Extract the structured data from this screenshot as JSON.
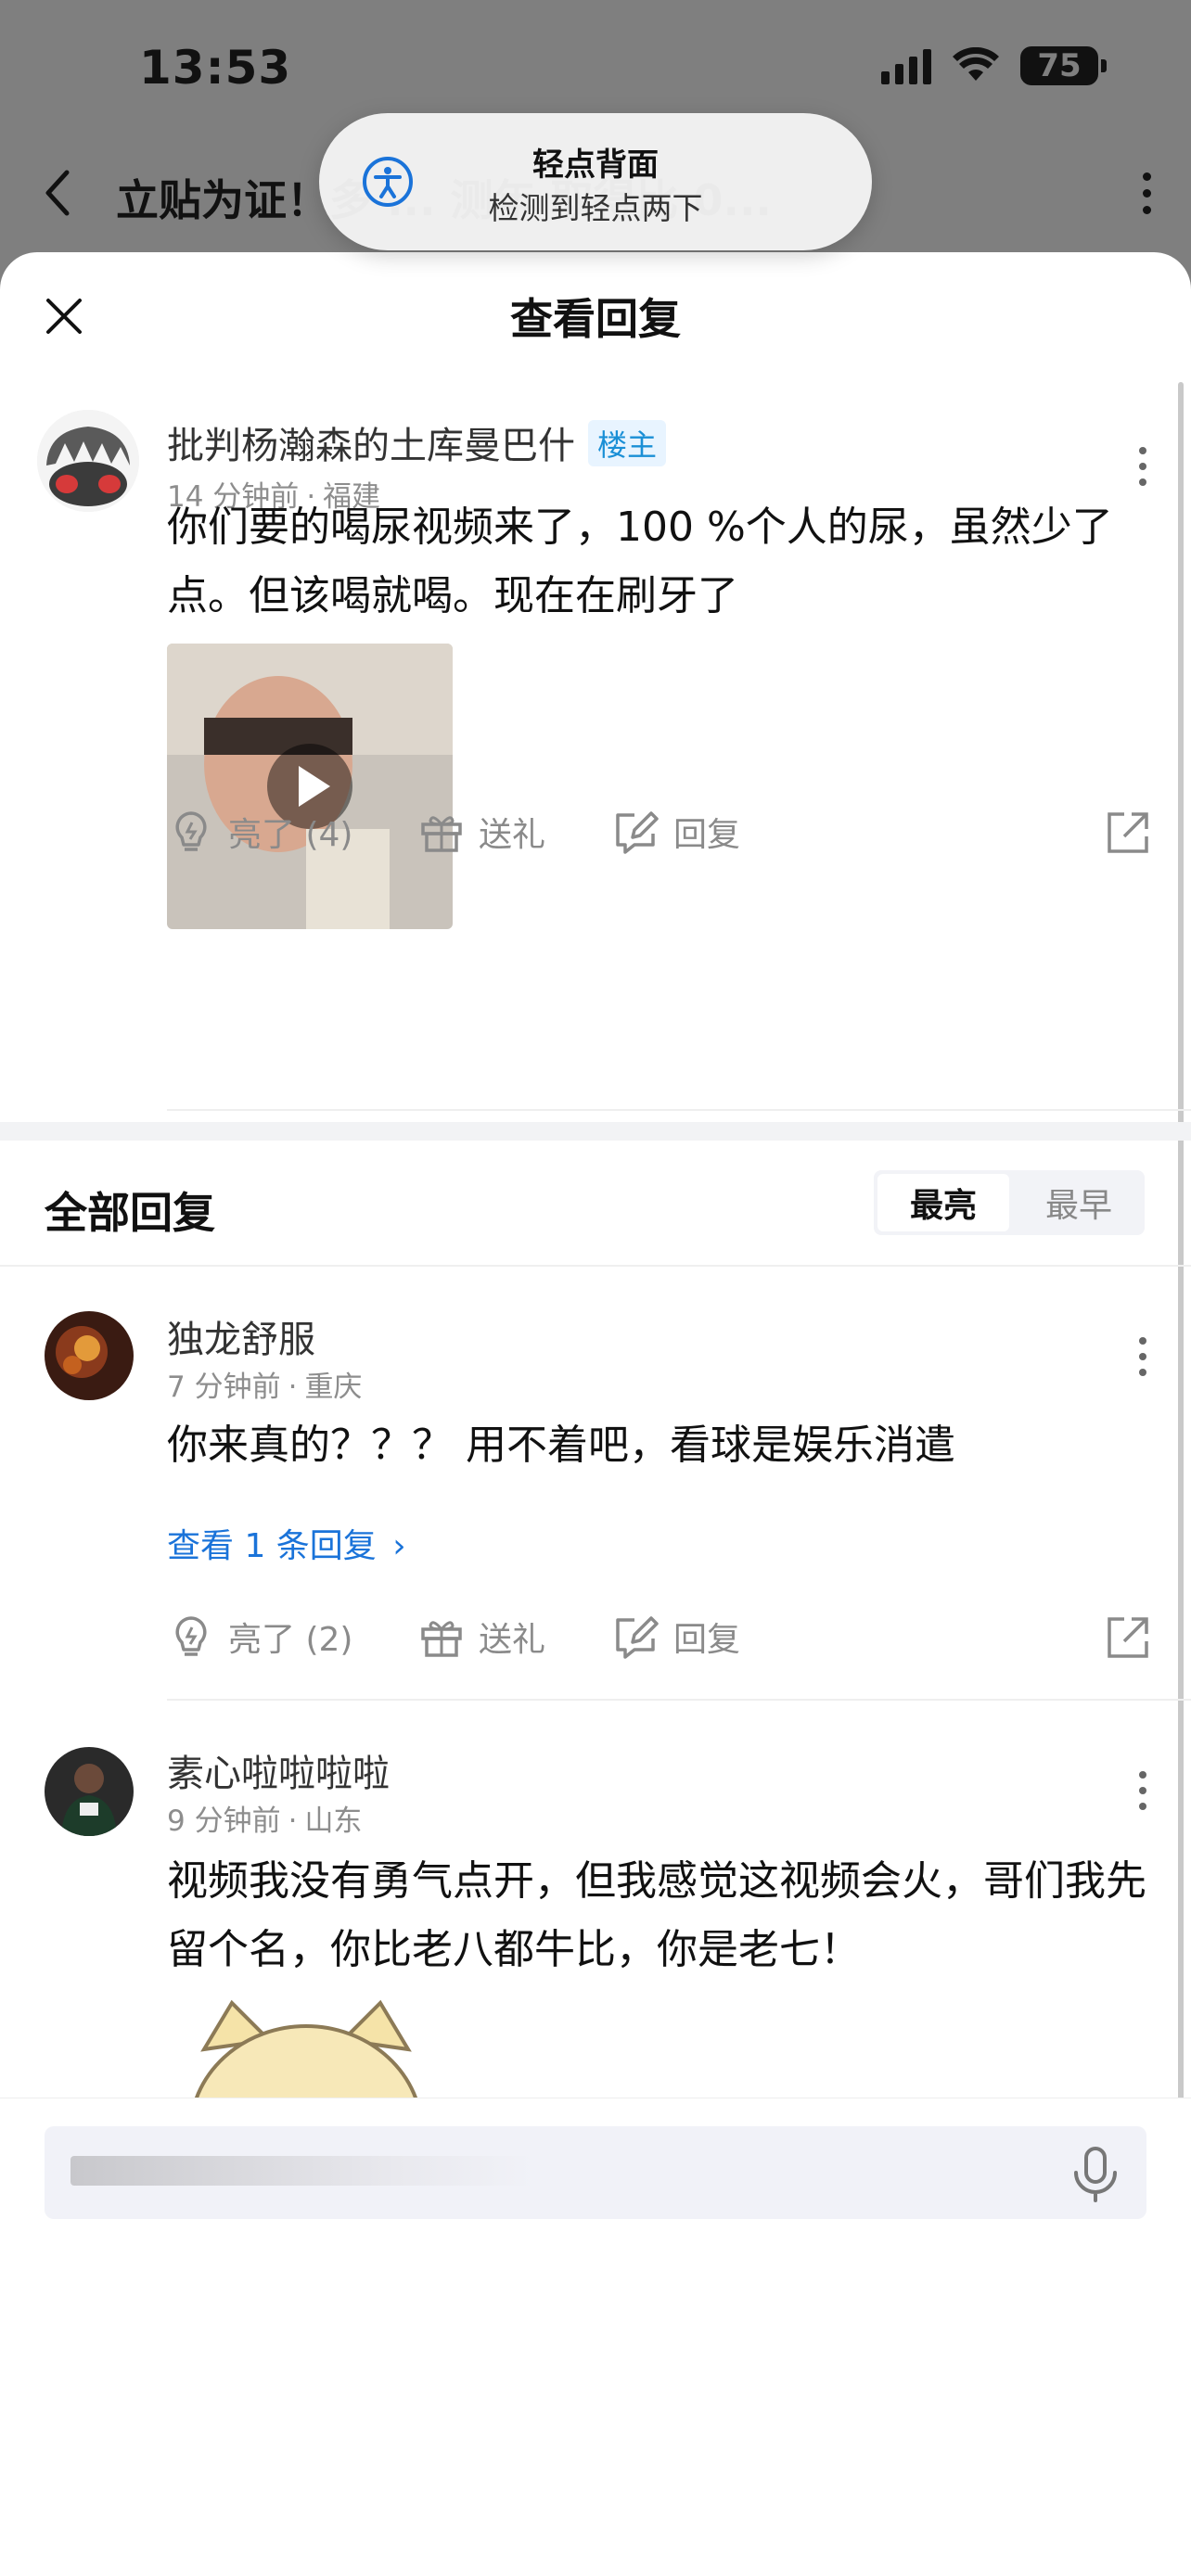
{
  "status_bar": {
    "time": "13:53",
    "battery": "75"
  },
  "background_nav": {
    "title": "立贴为证！多 ... 测年 取得比 0..."
  },
  "banner": {
    "title": "轻点背面",
    "subtitle": "检测到轻点两下"
  },
  "sheet": {
    "title": "查看回复"
  },
  "main_comment": {
    "author": "批判杨瀚森的土库曼巴什",
    "badge": "楼主",
    "time": "14 分钟前",
    "location": "福建",
    "text": "你们要的喝尿视频来了，100 %个人的尿，虽然少了点。但该喝就喝。现在在刷牙了",
    "actions": {
      "like": "亮了 (4)",
      "gift": "送礼",
      "reply": "回复"
    }
  },
  "all_replies": {
    "title": "全部回复",
    "sort": {
      "hot": "最亮",
      "early": "最早"
    }
  },
  "replies": [
    {
      "author": "独龙舒服",
      "time": "7 分钟前",
      "location": "重庆",
      "text": "你来真的？？？ 用不着吧，看球是娱乐消遣",
      "view_replies": "查看 1 条回复",
      "actions": {
        "like": "亮了 (2)",
        "gift": "送礼",
        "reply": "回复"
      }
    },
    {
      "author": "素心啦啦啦啦",
      "time": "9 分钟前",
      "location": "山东",
      "text": "视频我没有勇气点开，但我感觉这视频会火，哥们我先留个名，你比老八都牛比，你是老七！"
    }
  ],
  "colors": {
    "link": "#1a73d9",
    "badge": "#1a8fd6",
    "muted": "#8d8d8d"
  }
}
